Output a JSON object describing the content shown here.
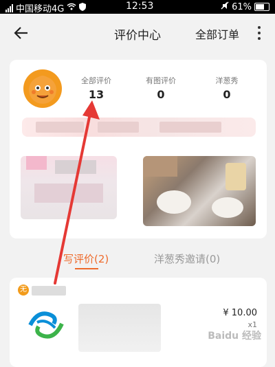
{
  "status_bar": {
    "carrier": "中国移动4G",
    "time": "12:53",
    "battery": "61%"
  },
  "nav": {
    "title": "评价中心",
    "orders_label": "全部订单"
  },
  "stats": [
    {
      "label": "全部评价",
      "value": "13"
    },
    {
      "label": "有图评价",
      "value": "0"
    },
    {
      "label": "洋葱秀",
      "value": "0"
    }
  ],
  "tabs": [
    {
      "label": "写评价(2)",
      "active": true
    },
    {
      "label": "洋葱秀邀请(0)",
      "active": false
    }
  ],
  "order": {
    "price": "¥ 10.00",
    "qty": "x1",
    "badge": "无"
  },
  "watermark": "Baidu 经验",
  "colors": {
    "accent": "#ee6a2b",
    "annotation": "#e53935",
    "avatar": "#f39a1e"
  }
}
